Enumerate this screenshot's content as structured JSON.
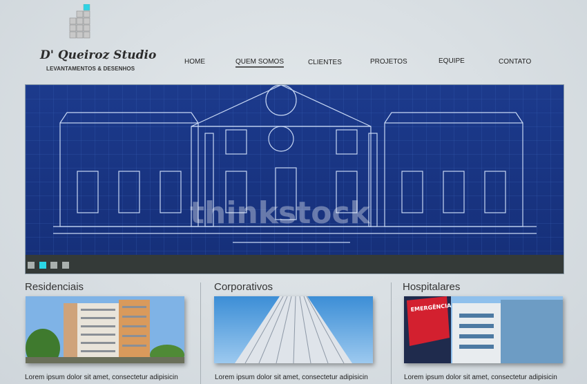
{
  "logo": {
    "name": "D' Queiroz Studio",
    "tagline": "LEVANTAMENTOS & DESENHOS"
  },
  "nav": {
    "items": [
      "HOME",
      "QUEM SOMOS",
      "CLIENTES",
      "PROJETOS",
      "EQUIPE",
      "CONTATO"
    ],
    "active": "QUEM SOMOS"
  },
  "banner": {
    "watermark": "thinkstock",
    "slides_total": 4,
    "active_slide": 2
  },
  "columns": [
    {
      "title": "Residenciais",
      "text": "Lorem ipsum dolor sit amet, consectetur adipisicin"
    },
    {
      "title": "Corporativos",
      "text": "Lorem ipsum dolor sit amet, consectetur adipisicin"
    },
    {
      "title": "Hospitalares",
      "text": "Lorem ipsum dolor sit amet, consectetur adipisicin",
      "sign_text": "EMERGÊNCIA"
    }
  ],
  "colors": {
    "blueprint": "#1a3f91",
    "slider_bar": "#343a38",
    "active_dot": "#2ad6e6",
    "emergency_red": "#d3202f"
  }
}
